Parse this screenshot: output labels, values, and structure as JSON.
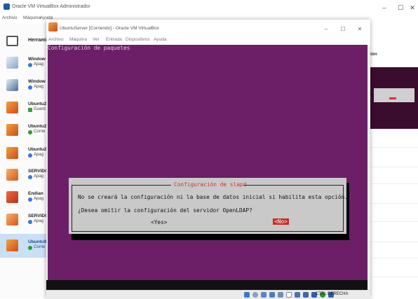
{
  "manager": {
    "title": "Oracle VM VirtualBox Administrador",
    "window_controls": [
      "–",
      "☐",
      "✕"
    ],
    "menu": [
      "Archivo",
      "Máquina",
      "Ayuda"
    ],
    "tools_label": "Herrami",
    "vms": [
      {
        "name": "Window",
        "state": "Apag",
        "icon": "windows-7-icon",
        "state_color": "#3b78d8"
      },
      {
        "name": "Window",
        "state": "Apag",
        "icon": "windows-10-icon",
        "state_color": "#3b78d8"
      },
      {
        "name": "Ubuntu2",
        "state": "Guard",
        "icon": "ubuntu-icon",
        "state_color": "#3a9f3a"
      },
      {
        "name": "Ubuntu2",
        "state": "Corrie",
        "icon": "ubuntu-icon",
        "state_color": "#2e9e2e"
      },
      {
        "name": "Ubuntu2",
        "state": "Apag",
        "icon": "ubuntu-icon",
        "state_color": "#3b78d8"
      },
      {
        "name": "SERVIDO",
        "state": "Apag",
        "icon": "ubuntu-icon",
        "state_color": "#3b78d8"
      },
      {
        "name": "Endian",
        "state": "Apag",
        "icon": "endian-icon",
        "state_color": "#3b78d8"
      },
      {
        "name": "SERVIDO",
        "state": "Apag",
        "icon": "ubuntu-icon",
        "state_color": "#3b78d8"
      },
      {
        "name": "Ubuntu9",
        "state": "Corrie",
        "icon": "ubuntu-icon",
        "state_color": "#2e9e2e",
        "selected": true
      }
    ],
    "right_panel_label": "ión"
  },
  "vm_window": {
    "title": "UbuntuServer [Corriendo] - Oracle VM VirtualBox",
    "window_controls": [
      "–",
      "☐",
      "✕"
    ],
    "menu": [
      "Archivo",
      "Máquina",
      "Ver",
      "Entrada",
      "Dispositivos",
      "Ayuda"
    ],
    "screen_header": "Configuración de paquetes",
    "dialog": {
      "title": "Configuración de slapd",
      "line1": "No se creará la configuración ni la base de datos inicial si habilita esta opción.",
      "line2": "¿Desea omitir la configuración del servidor OpenLDAP?",
      "yes": "<Yes>",
      "no": "<No>"
    },
    "host_key": "CTRL DERECHA"
  },
  "colors": {
    "guest_background": "#6c1f67",
    "dialog_background": "#c9c9c9",
    "selected_button": "#c62d24",
    "selection_highlight": "#c9dff6"
  }
}
